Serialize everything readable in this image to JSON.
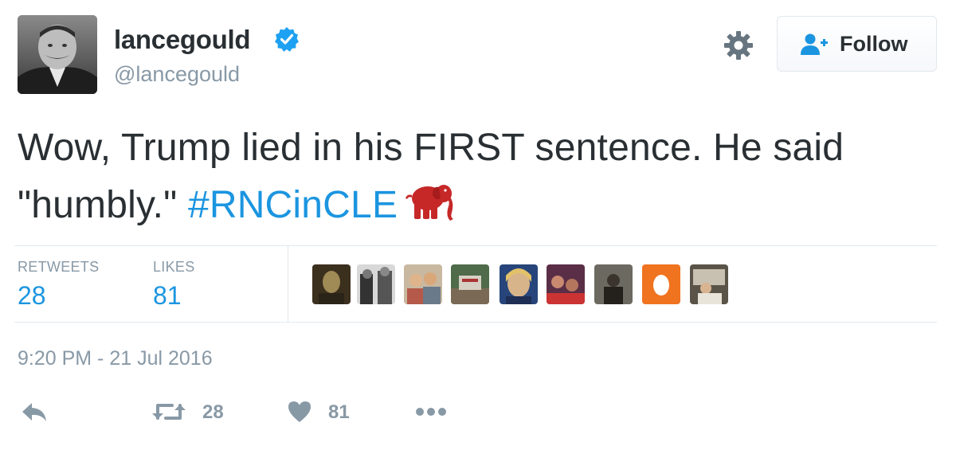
{
  "user": {
    "display_name": "lancegould",
    "screen_name": "@lancegould",
    "verified_icon": "verified-badge-icon"
  },
  "header": {
    "settings_icon": "gear-icon",
    "follow_label": "Follow",
    "follow_icon": "follow-person-plus-icon"
  },
  "tweet": {
    "text_line": "Wow, Trump lied in his FIRST sentence. He said \"humbly.\"",
    "hashtag": "#RNCinCLE",
    "emoji_icon": "red-elephant-icon"
  },
  "stats": {
    "retweets_label": "RETWEETS",
    "retweets_value": "28",
    "likes_label": "LIKES",
    "likes_value": "81"
  },
  "timestamp": "9:20 PM - 21 Jul 2016",
  "actions": {
    "reply_icon": "reply-icon",
    "retweet_icon": "retweet-icon",
    "retweet_count": "28",
    "like_icon": "heart-icon",
    "like_count": "81",
    "more_icon": "more-dots-icon"
  },
  "colors": {
    "link_blue": "#1b95e0",
    "muted_gray": "#8899a6",
    "text": "#292f33",
    "elephant_red": "#c62828"
  }
}
